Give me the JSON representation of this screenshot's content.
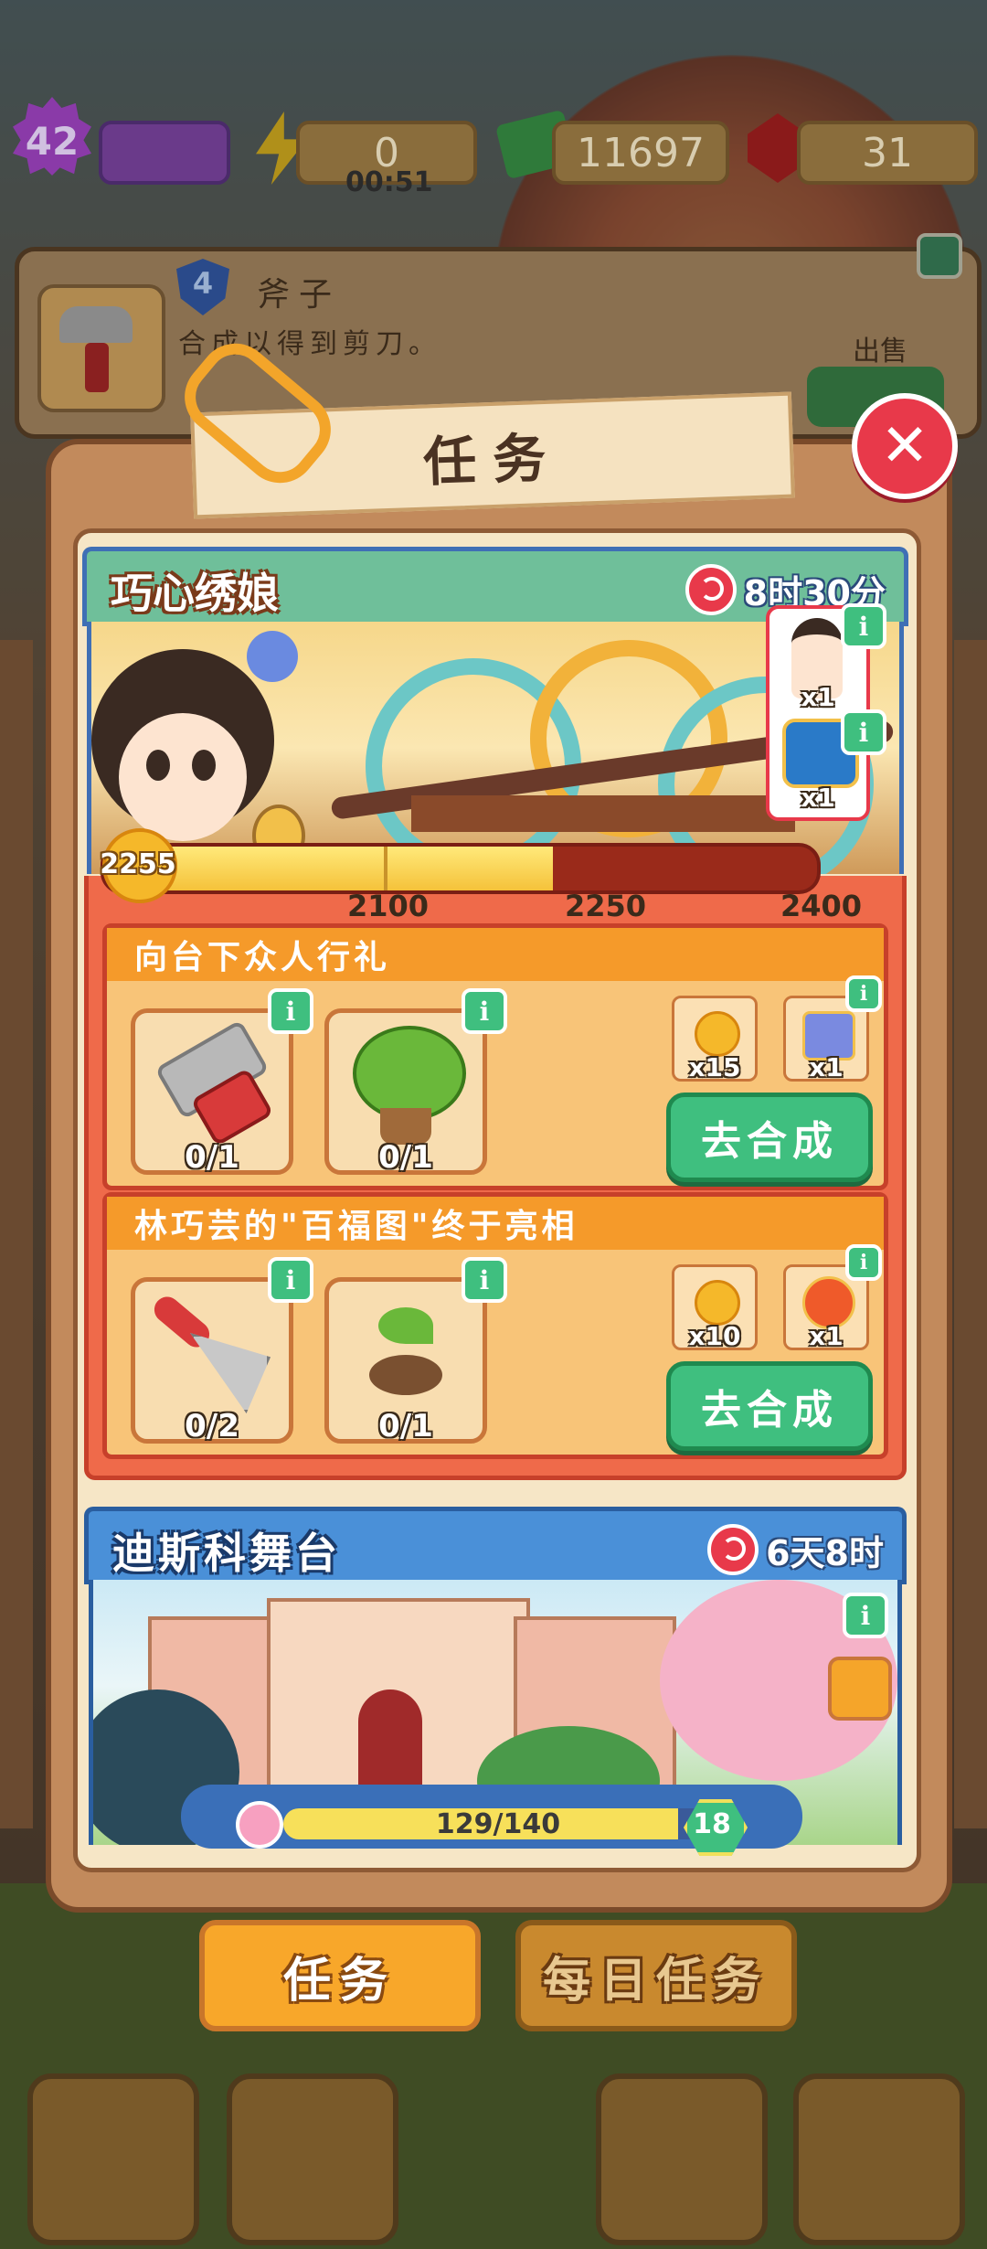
{
  "hud": {
    "level": "42",
    "energy": "0",
    "energy_timer": "00:51",
    "cash": "11697",
    "gems": "31"
  },
  "info_card": {
    "level": "4",
    "item_name": "斧子",
    "description": "合成以得到剪刀。",
    "sell_label": "出售"
  },
  "dialog": {
    "title": "任务",
    "close_icon": "close-icon"
  },
  "event1": {
    "title": "巧心绣娘",
    "timer": "8时30分",
    "rewards": [
      {
        "icon": "character-icon",
        "count": "x1"
      },
      {
        "icon": "treasure-chest-icon",
        "count": "x1"
      }
    ],
    "score": "2255",
    "ticks": [
      "2100",
      "2250",
      "2400"
    ],
    "progress": 0.63,
    "tasks": [
      {
        "title": "向台下众人行礼",
        "items": [
          {
            "icon": "hedge-trimmer-icon",
            "count": "0/1"
          },
          {
            "icon": "potted-tree-icon",
            "count": "0/1"
          }
        ],
        "rewards": [
          {
            "icon": "flower-token-icon",
            "count": "x15"
          },
          {
            "icon": "gift-box-icon",
            "count": "x1"
          }
        ],
        "button": "去合成"
      },
      {
        "title": "林巧芸的\"百福图\"终于亮相",
        "items": [
          {
            "icon": "rake-icon",
            "count": "0/2"
          },
          {
            "icon": "sprout-icon",
            "count": "0/1"
          }
        ],
        "rewards": [
          {
            "icon": "flower-token-icon",
            "count": "x10"
          },
          {
            "icon": "energy-icon",
            "count": "x1"
          }
        ],
        "button": "去合成"
      }
    ]
  },
  "event2": {
    "title": "迪斯科舞台",
    "timer": "6天8时",
    "progress_text": "129/140",
    "progress": 0.92,
    "level": "18"
  },
  "tabs": {
    "active": "任务",
    "inactive": "每日任务"
  },
  "colors": {
    "accent_orange": "#f5a52a",
    "button_green": "#3fbf7f",
    "close_red": "#e8394a"
  }
}
